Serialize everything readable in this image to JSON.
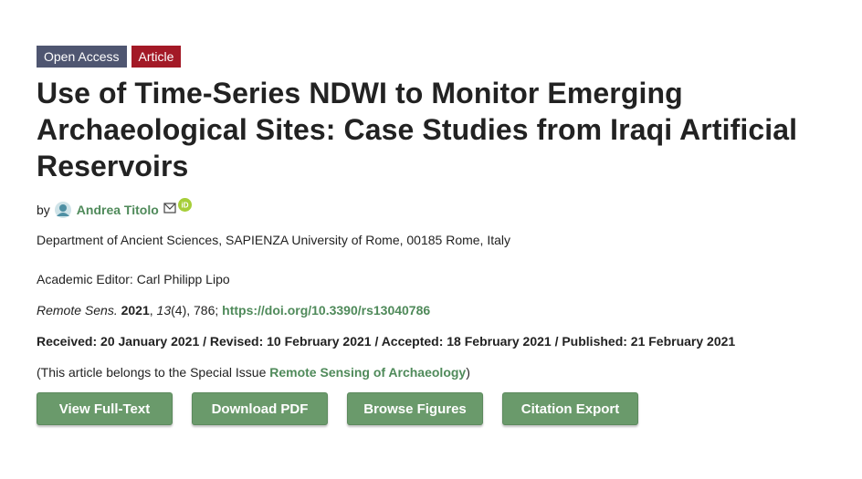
{
  "badges": {
    "open_access": "Open Access",
    "article": "Article"
  },
  "title": "Use of Time-Series NDWI to Monitor Emerging Archaeological Sites: Case Studies from Iraqi Artificial Reservoirs",
  "authors": {
    "by": "by",
    "name": "Andrea Titolo",
    "icons": [
      "author-avatar-icon",
      "mail-icon",
      "orcid-icon"
    ]
  },
  "affiliation": "Department of Ancient Sciences, SAPIENZA University of Rome, 00185 Rome, Italy",
  "editor": "Academic Editor: Carl Philipp Lipo",
  "citation": {
    "journal": "Remote Sens.",
    "year": "2021",
    "volume": "13",
    "issue_pages": "(4), 786;",
    "doi": "https://doi.org/10.3390/rs13040786"
  },
  "dates": "Received: 20 January 2021 / Revised: 10 February 2021 / Accepted: 18 February 2021 / Published: 21 February 2021",
  "special_issue": {
    "prefix": "(This article belongs to the Special Issue ",
    "link": "Remote Sensing of Archaeology",
    "suffix": ")"
  },
  "buttons": {
    "full_text": "View Full-Text",
    "pdf": "Download PDF",
    "figures": "Browse Figures",
    "citation": "Citation Export"
  },
  "colors": {
    "accent_green": "#4f8a5a",
    "button_green": "#6a9a6b",
    "open_access_bg": "#4f5671",
    "article_bg": "#a31926"
  }
}
